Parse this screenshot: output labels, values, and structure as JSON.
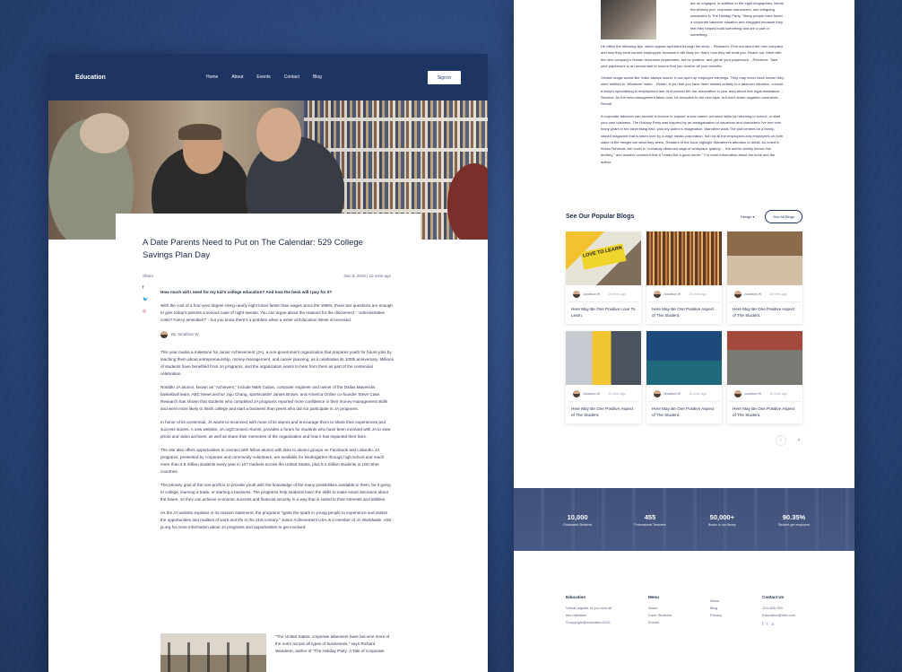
{
  "nav": {
    "logo": "Education",
    "links": [
      "Home",
      "About",
      "Events",
      "Contact",
      "Blog"
    ],
    "signin": "Sign in"
  },
  "article": {
    "title": "A Date Parents Need to Put on The Calendar: 529 College Savings Plan Day",
    "share": "Share",
    "date": "Nov 5, 2019",
    "readtime": "10 mins ago",
    "question": "How much will I need for my kid's college education? And how the heck will I pay for it?",
    "p1": "With the cost of a four-year degree rising nearly eight times faster than wages since the 1980s, those two questions are enough to give today's parents a serious case of night sweats. You can argue about the reasons for the disconnect - 'Administrative costs? Fancy amenities?' - but you know there's a problem when a writer at Education Week is incensed.",
    "author": "By Jonathon W",
    "p2": "This year marks a milestone for Junior Achievement (JA), a non-government organization that prepares youth for future jobs by teaching them about entrepreneurship, money management, and career planning, as it celebrates its 100th anniversary. Millions of students have benefited from JA programs, and the organization wants to hear from them as part of the centennial celebration.",
    "p3": "Notable JA alumni, known as \"Achievers,\" include Mark Cuban, computer engineer and owner of the Dallas Mavericks basketball team, ABC News anchor Juju Chang, sportscaster James Brown, and America Online co-founder Steve Case. Research has shown that students who completed JA programs reported more confidence in their money-management skills and were more likely to finish college and start a business than peers who did not participate in JA programs.",
    "p4": "In honor of its centennial, JA wants to reconnect with more of its alumni and encourage them to share their experiences and success stories. A new website, JA.org/Connect Alumni, provides a forum for students who have been involved with JA to view photo and video archives, as well as share their memories of the organization and how it has impacted their lives.",
    "p5": "The site also offers opportunities to connect with fellow alumni with links to alumni groups on Facebook and LinkedIn. JA programs, presented by corporate and community volunteers, are available for kindergarten through high school and reach more than 4.8 million students every year in 107 markets across the United States, plus 5.2 million students in 100 other countries.",
    "p6": "The primary goal of the non-profit is to provide youth with the knowledge of the many possibilities available to them, be it going to college, learning a trade, or starting a business. The programs help students learn the skills to make smart decisions about the future, so they can achieve economic success and financial security in a way that is suited to their interests and abilities.",
    "p7": "As the JA website explains in its mission statement, the programs \"ignite the spark in young people to experience and realize the opportunities and realities of work and life in the 21st century.\" Junior Achievement USA is a member of JA Worldwide. Visit ja.org for more information about JA programs and opportunities to get involved.",
    "quote": "\"The United States, corporate takeovers have become more of the norm across all types of businesses,\" says Richard Wanderer, author of \"The Holiday Party: A Tale of Corporate"
  },
  "right": {
    "side_text": "are as engaged, in addition to the eight biographies, inform the whimsy plot, corporate maneuvers, and intriguing characters in The Holiday Party. \"Many people have faced a corporate takeover situation and struggled because they feel they helped build something and are a part of something.",
    "t1": "He offers the following tips, which appear sprinkled through the story: - Research. Find out about the new company and how they treat current employees, because it will likely be, that's how they will treat you. Reach out. Meet with the new company's human resources department, but be positive, and get all your paperwork. - Reinforce. Take your paperwork to an accountant to ensure that you receive all your benefits.",
    "t2": "Certain magic words like 'folks' always sound. It can open up employee earnings. They may never have known they were entitled to. Whatever notes. - Retain. If you feel you have been treated unfairly in a takeover situation, consult a lawyer specializing in employment law. And contact the bar association in your area about free legal assistance. - Receive. As the new management takes over, be receptive to the new style, but don't share negative comments. - Revisit.",
    "t3": "A corporate takeover can provide a chance to explore a new career, enhance skills by returning to school, or start your own business. The Holiday Party was inspired by an amalgamation of situations and characters I've met over many years in the advertising field, plus my author's imagination. Wanderer adds The plot centers on a family-owned magazine that is taken over by a large media corporation, but not all the employees and employees on both sides of the merger are what they seem. Readers of the book highlight Wanderer's attention to detail. As noted in Kirkus Reviews, the novel is \"a sharply observed saga of workplace tyranny ... the author clearly knows this territory,\" and readers comment that it \"reads like a good movie.\" For more information about the book and the author.",
    "popular_heading": "See Our Popular Blogs",
    "filter": "Design ▾",
    "see_all": "See All Blogs",
    "cards": [
      {
        "author": "Jonathon W",
        "date": "10 mins ago",
        "title": "Here May Be One Positive Love To Learn.",
        "thumb_text": "LOVE TO LEARN"
      },
      {
        "author": "Jonathon W",
        "date": "10 mins ago",
        "title": "Here May Be One Positive Aspect of The Student."
      },
      {
        "author": "Jonathon W",
        "date": "10 mins ago",
        "title": "Here May Be One Positive Aspect of The Student."
      },
      {
        "author": "Jonathon W",
        "date": "10 mins ago",
        "title": "Here May Be One Positive Aspect of The Student."
      },
      {
        "author": "Jonathon W",
        "date": "10 mins ago",
        "title": "Here May Be One Positive Aspect of The Student."
      },
      {
        "author": "Jonathon W",
        "date": "10 mins ago",
        "title": "Here May Be One Positive Aspect of The Student."
      }
    ],
    "pager": {
      "prev": "‹",
      "next": "›"
    },
    "stats": [
      {
        "n": "10,000",
        "l": "Graduated Students"
      },
      {
        "n": "455",
        "l": "Professional Teachers"
      },
      {
        "n": "50,000+",
        "l": "Books In our library"
      },
      {
        "n": "90.35%",
        "l": "Student get employed"
      }
    ],
    "footer": {
      "c1": {
        "h": "Education",
        "lines": [
          "Virtual register to you how all",
          "this mistaken",
          "©copyright@education2019"
        ]
      },
      "c2": {
        "h": "Menu",
        "lines": [
          "About",
          "Case Students",
          "Events"
        ]
      },
      "c3": {
        "h": "",
        "lines": [
          "News",
          "Blog",
          "Privacy"
        ]
      },
      "c4": {
        "h": "Contact Us",
        "lines": [
          "123-456-789",
          "Education@info.com"
        ]
      },
      "socials": [
        "f",
        "t",
        "o"
      ]
    }
  }
}
